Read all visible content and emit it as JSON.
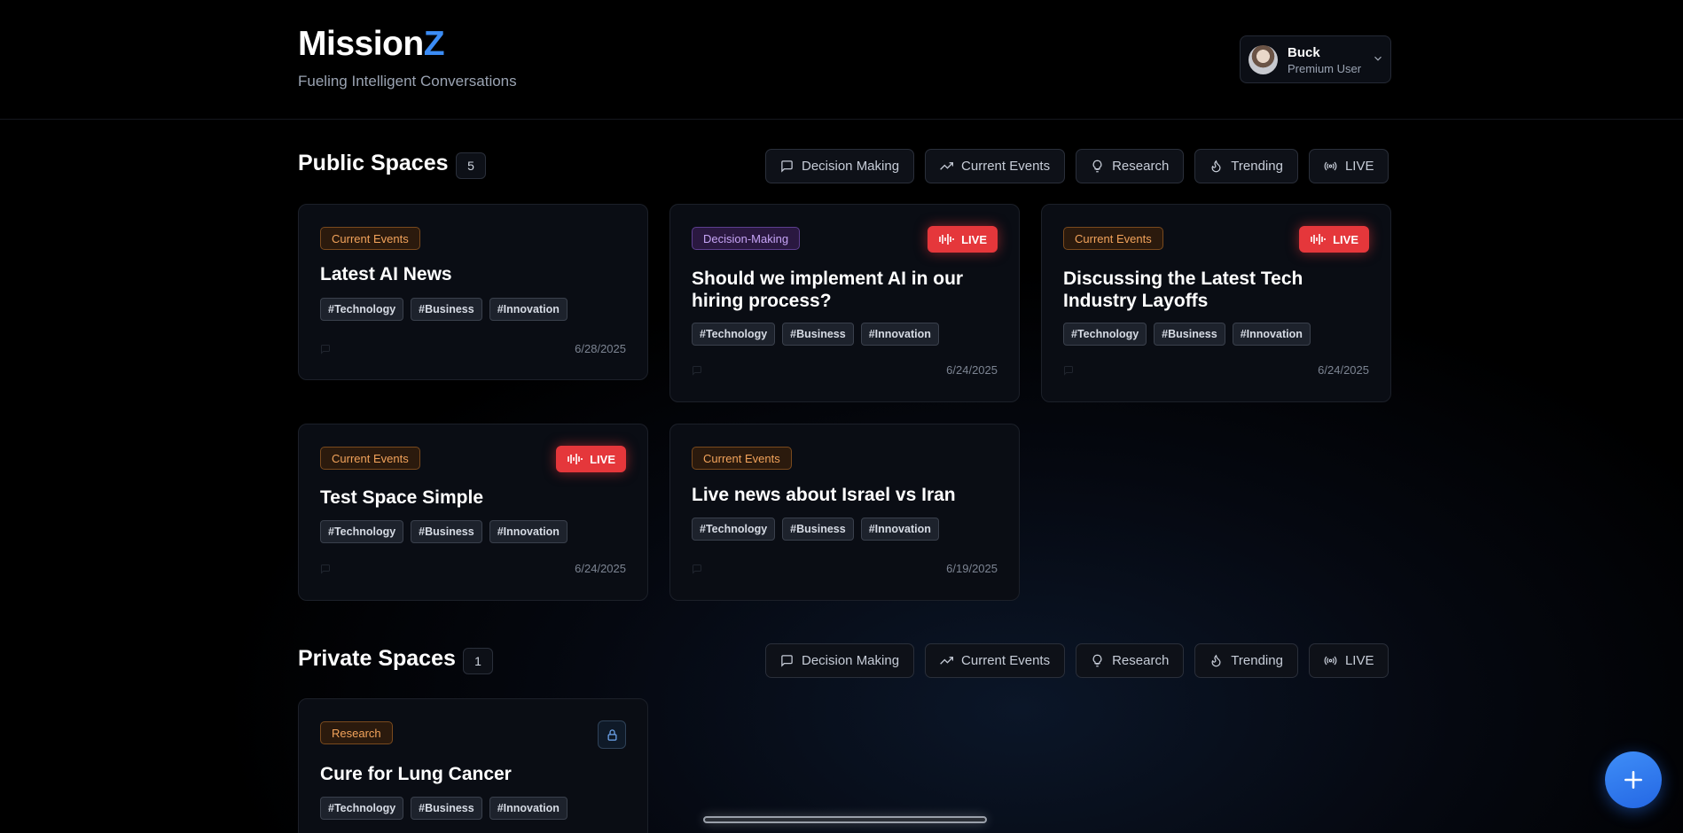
{
  "brand": {
    "name_main": "Mission",
    "name_accent": "Z",
    "tagline": "Fueling Intelligent Conversations"
  },
  "user": {
    "name": "Buck",
    "role": "Premium User"
  },
  "filters": [
    {
      "label": "Decision Making",
      "icon": "message-square-icon"
    },
    {
      "label": "Current Events",
      "icon": "trending-up-icon"
    },
    {
      "label": "Research",
      "icon": "lightbulb-icon"
    },
    {
      "label": "Trending",
      "icon": "flame-icon"
    },
    {
      "label": "LIVE",
      "icon": "broadcast-icon"
    }
  ],
  "public_spaces": {
    "title": "Public Spaces",
    "count": "5",
    "cards": [
      {
        "category": "Current Events",
        "title": "Latest AI News",
        "live": false,
        "tags": [
          "#Technology",
          "#Business",
          "#Innovation"
        ],
        "messages": "0",
        "date": "6/28/2025"
      },
      {
        "category": "Decision-Making",
        "title": "Should we implement AI in our hiring process?",
        "live": true,
        "tags": [
          "#Technology",
          "#Business",
          "#Innovation"
        ],
        "messages": "0",
        "date": "6/24/2025"
      },
      {
        "category": "Current Events",
        "title": "Discussing the Latest Tech Industry Layoffs",
        "live": true,
        "tags": [
          "#Technology",
          "#Business",
          "#Innovation"
        ],
        "messages": "0",
        "date": "6/24/2025"
      },
      {
        "category": "Current Events",
        "title": "Test Space Simple",
        "live": true,
        "tags": [
          "#Technology",
          "#Business",
          "#Innovation"
        ],
        "messages": "0",
        "date": "6/24/2025"
      },
      {
        "category": "Current Events",
        "title": "Live news about Israel vs Iran",
        "live": false,
        "tags": [
          "#Technology",
          "#Business",
          "#Innovation"
        ],
        "messages": "0",
        "date": "6/19/2025"
      }
    ]
  },
  "private_spaces": {
    "title": "Private Spaces",
    "count": "1",
    "cards": [
      {
        "category": "Research",
        "title": "Cure for Lung Cancer",
        "locked": true,
        "tags": [
          "#Technology",
          "#Business",
          "#Innovation"
        ]
      }
    ]
  },
  "live_label": "LIVE",
  "colors": {
    "accent": "#3b8cf5",
    "live": "#e5373b",
    "category_orange": "#f2a35b",
    "category_purple": "#c6a4f5"
  }
}
